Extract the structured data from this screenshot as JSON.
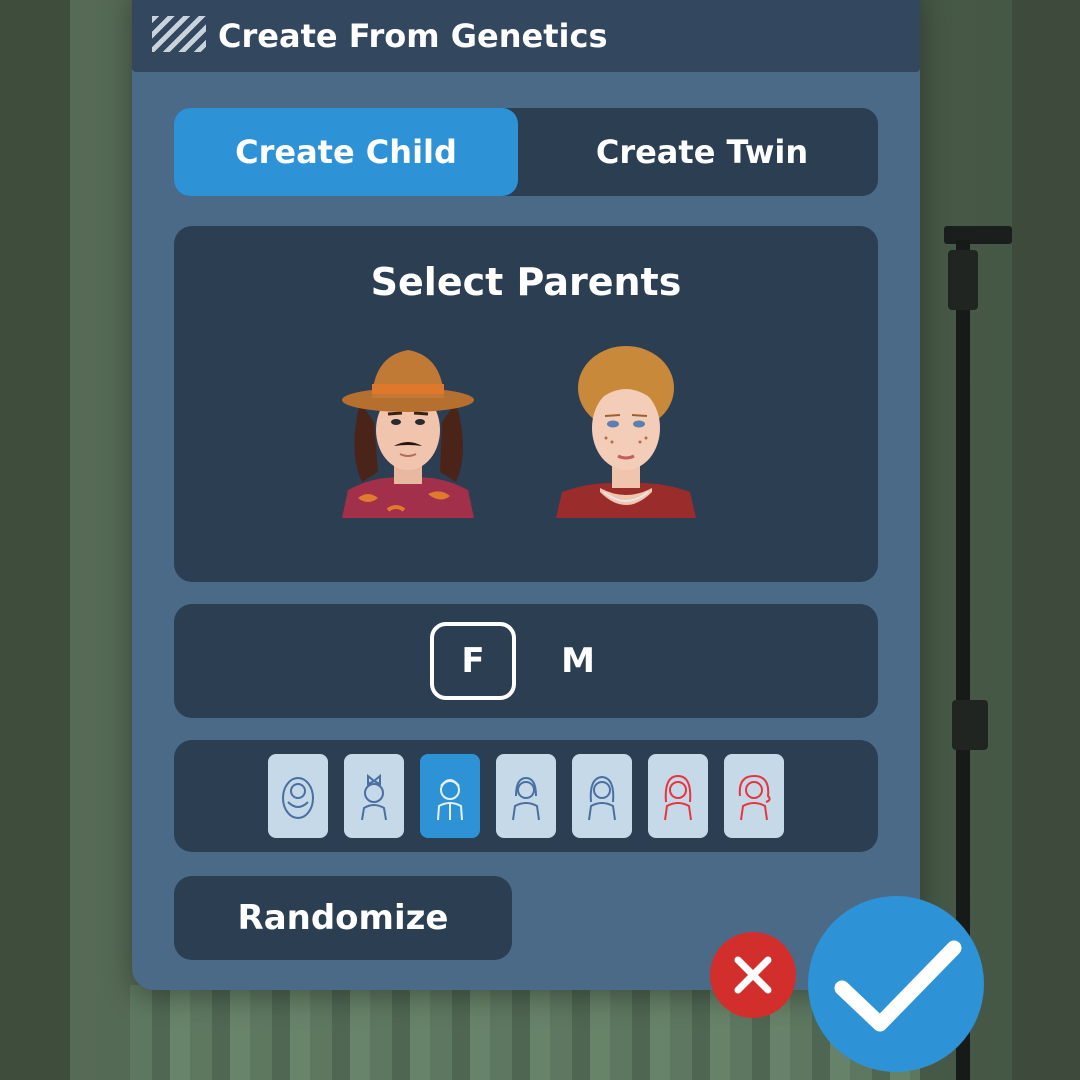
{
  "window": {
    "title": "Create From Genetics",
    "title_icon": "stripes-icon"
  },
  "tabs": [
    {
      "label": "Create Child",
      "selected": true
    },
    {
      "label": "Create Twin",
      "selected": false
    }
  ],
  "parents": {
    "heading": "Select Parents",
    "items": [
      {
        "icon": "male-parent-portrait"
      },
      {
        "icon": "female-parent-portrait"
      }
    ]
  },
  "gender": {
    "options": [
      {
        "label": "F",
        "selected": true
      },
      {
        "label": "M",
        "selected": false
      }
    ]
  },
  "ages": {
    "items": [
      {
        "icon": "baby-icon",
        "selected": false
      },
      {
        "icon": "toddler-icon",
        "selected": false
      },
      {
        "icon": "child-icon",
        "selected": true
      },
      {
        "icon": "teen-icon",
        "selected": false
      },
      {
        "icon": "young-adult-icon",
        "selected": false
      },
      {
        "icon": "adult-icon",
        "selected": false
      },
      {
        "icon": "elder-icon",
        "selected": false
      }
    ]
  },
  "actions": {
    "randomize_label": "Randomize",
    "cancel_icon": "close-icon",
    "confirm_icon": "checkmark-icon"
  },
  "colors": {
    "accent": "#2d93d6",
    "panel": "#4a6a88",
    "card": "#2c3e52",
    "cancel": "#d22f2c",
    "age_tile": "#c5d9e8",
    "age_icon_locked": "#e8343c"
  }
}
